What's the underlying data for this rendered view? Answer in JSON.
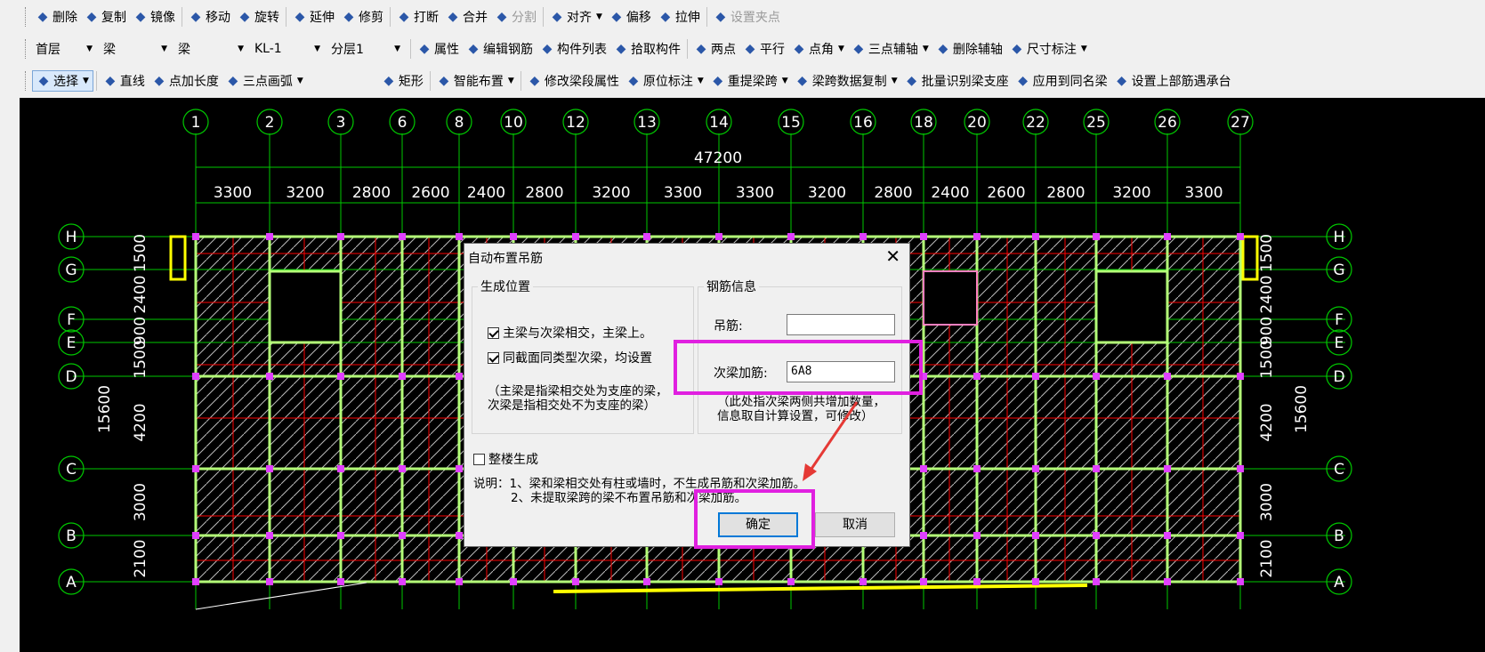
{
  "toolbar1": [
    {
      "icon": "pen-eraser-icon",
      "label": "删除"
    },
    {
      "icon": "copy-icon",
      "label": "复制"
    },
    {
      "icon": "mirror-icon",
      "label": "镜像"
    },
    {
      "icon": "move-icon",
      "label": "移动"
    },
    {
      "icon": "rotate-icon",
      "label": "旋转"
    },
    {
      "icon": "extend-icon",
      "label": "延伸"
    },
    {
      "icon": "trim-icon",
      "label": "修剪"
    },
    {
      "icon": "break-icon",
      "label": "打断"
    },
    {
      "icon": "merge-icon",
      "label": "合并"
    },
    {
      "icon": "split-icon",
      "label": "分割",
      "disabled": true
    },
    {
      "icon": "align-icon",
      "label": "对齐",
      "dropdown": true
    },
    {
      "icon": "offset-icon",
      "label": "偏移"
    },
    {
      "icon": "stretch-icon",
      "label": "拉伸"
    },
    {
      "icon": "grip-point-icon",
      "label": "设置夹点",
      "disabled": true
    }
  ],
  "toolbar2": {
    "selects": [
      "首层",
      "梁",
      "梁",
      "KL-1",
      "分层1"
    ],
    "buttons": [
      {
        "icon": "properties-icon",
        "label": "属性"
      },
      {
        "icon": "edit-rebar-icon",
        "label": "编辑钢筋"
      },
      {
        "icon": "component-list-icon",
        "label": "构件列表"
      },
      {
        "icon": "pick-component-icon",
        "label": "拾取构件"
      },
      {
        "icon": "two-point-icon",
        "label": "两点"
      },
      {
        "icon": "parallel-icon",
        "label": "平行"
      },
      {
        "icon": "point-angle-icon",
        "label": "点角",
        "dropdown": true
      },
      {
        "icon": "three-point-axis-icon",
        "label": "三点辅轴",
        "dropdown": true
      },
      {
        "icon": "delete-axis-icon",
        "label": "删除辅轴"
      },
      {
        "icon": "dimension-icon",
        "label": "尺寸标注",
        "dropdown": true
      }
    ]
  },
  "toolbar3": [
    {
      "icon": "cursor-icon",
      "label": "选择",
      "dropdown": true,
      "active": true
    },
    {
      "icon": "line-icon",
      "label": "直线"
    },
    {
      "icon": "point-length-icon",
      "label": "点加长度"
    },
    {
      "icon": "arc-icon",
      "label": "三点画弧",
      "dropdown": true
    },
    {
      "icon": "rectangle-icon",
      "label": "矩形"
    },
    {
      "icon": "smart-layout-icon",
      "label": "智能布置",
      "dropdown": true
    },
    {
      "icon": "modify-span-icon",
      "label": "修改梁段属性"
    },
    {
      "icon": "in-place-label-icon",
      "label": "原位标注",
      "dropdown": true
    },
    {
      "icon": "reextract-span-icon",
      "label": "重提梁跨",
      "dropdown": true
    },
    {
      "icon": "copy-span-data-icon",
      "label": "梁跨数据复制",
      "dropdown": true
    },
    {
      "icon": "batch-support-icon",
      "label": "批量识别梁支座"
    },
    {
      "icon": "apply-same-beam-icon",
      "label": "应用到同名梁"
    },
    {
      "icon": "upper-rebar-icon",
      "label": "设置上部筋遇承台"
    }
  ],
  "colors": {
    "grid": "#00c800",
    "axis_red": "#ff0000",
    "beam": "#b4ff78",
    "wall_pink": "#ff80c0",
    "column": "#e040ff",
    "yellow": "#ffff00",
    "highlight": "#e020e0",
    "arrow": "#e53935"
  },
  "drawing": {
    "axes_top": [
      "1",
      "2",
      "3",
      "6",
      "8",
      "10",
      "12",
      "13",
      "14",
      "15",
      "16",
      "18",
      "20",
      "22",
      "25",
      "26",
      "27"
    ],
    "total_width": "47200",
    "spans_top": [
      "3300",
      "3200",
      "2800",
      "2600",
      "2400",
      "2800",
      "3200",
      "3300",
      "3300",
      "3200",
      "2800",
      "2400",
      "2600",
      "2800",
      "3200",
      "3300"
    ],
    "axes_side": [
      "H",
      "G",
      "F",
      "E",
      "D",
      "C",
      "B",
      "A"
    ],
    "spans_side": [
      "1500",
      "2400",
      "900",
      "1500",
      "4200",
      "3000",
      "2100"
    ],
    "total_height": "15600"
  },
  "dialog": {
    "title": "自动布置吊筋",
    "close_glyph": "✕",
    "group1_title": "生成位置",
    "check1": "主梁与次梁相交，主梁上。",
    "check2": "同截面同类型次梁，均设置",
    "note1_line1": "（主梁是指梁相交处为支座的梁，",
    "note1_line2": "次梁是指相交处不为支座的梁）",
    "group2_title": "钢筋信息",
    "hanger_label": "吊筋:",
    "hanger_value": "",
    "secondary_label": "次梁加筋:",
    "secondary_value": "6A8",
    "note2_line1": "（此处指次梁两侧共增加数量，",
    "note2_line2": "信息取自计算设置，可修改）",
    "whole_building": "整楼生成",
    "desc1": "说明：1、梁和梁相交处有柱或墙时，不生成吊筋和次梁加筋。",
    "desc2": "2、未提取梁跨的梁不布置吊筋和次梁加筋。",
    "ok": "确定",
    "cancel": "取消"
  }
}
